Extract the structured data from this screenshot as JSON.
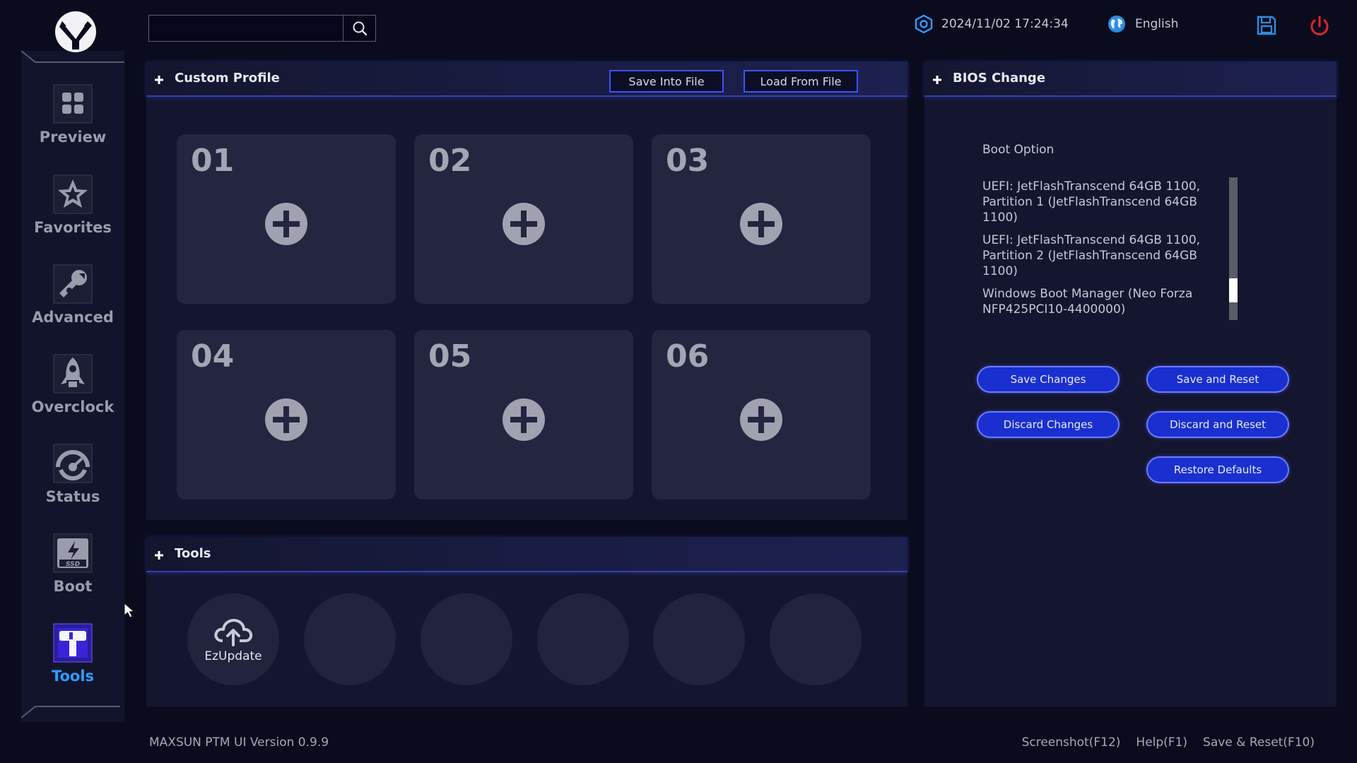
{
  "app": {
    "datetime": "2024/11/02 17:24:34",
    "language": "English",
    "version": "MAXSUN PTM UI Version 0.9.9",
    "accent_color": "#3c53ff",
    "active_color": "#2f9bff"
  },
  "search": {
    "value": "",
    "placeholder": ""
  },
  "sidebar": {
    "items": [
      {
        "label": "Preview",
        "icon": "grid-icon",
        "active": false
      },
      {
        "label": "Favorites",
        "icon": "star-icon",
        "active": false
      },
      {
        "label": "Advanced",
        "icon": "wrench-icon",
        "active": false
      },
      {
        "label": "Overclock",
        "icon": "rocket-icon",
        "active": false
      },
      {
        "label": "Status",
        "icon": "gauge-icon",
        "active": false
      },
      {
        "label": "Boot",
        "icon": "ssd-icon",
        "active": false
      },
      {
        "label": "Tools",
        "icon": "toolbox-icon",
        "active": true
      }
    ]
  },
  "custom_profile": {
    "title": "Custom Profile",
    "save_label": "Save Into File",
    "load_label": "Load From File",
    "slots": [
      "01",
      "02",
      "03",
      "04",
      "05",
      "06"
    ]
  },
  "tools": {
    "title": "Tools",
    "items": [
      {
        "label": "EzUpdate",
        "icon": "cloud-upload-icon"
      },
      {
        "label": "",
        "icon": ""
      },
      {
        "label": "",
        "icon": ""
      },
      {
        "label": "",
        "icon": ""
      },
      {
        "label": "",
        "icon": ""
      },
      {
        "label": "",
        "icon": ""
      }
    ]
  },
  "bios_change": {
    "title": "BIOS Change",
    "boot_option_label": "Boot Option",
    "boot_options": [
      "UEFI: JetFlashTranscend 64GB 1100, Partition 1 (JetFlashTranscend 64GB 1100)",
      "UEFI: JetFlashTranscend 64GB 1100, Partition 2 (JetFlashTranscend 64GB 1100)",
      "Windows Boot Manager (Neo Forza NFP425PCI10-4400000)"
    ],
    "scroll_position": 0.85,
    "buttons": {
      "save_changes": "Save Changes",
      "save_and_reset": "Save and Reset",
      "discard_changes": "Discard Changes",
      "discard_and_reset": "Discard and Reset",
      "restore_defaults": "Restore Defaults"
    }
  },
  "footer": {
    "screenshot": "Screenshot(F12)",
    "help": "Help(F1)",
    "save_reset": "Save & Reset(F10)"
  }
}
